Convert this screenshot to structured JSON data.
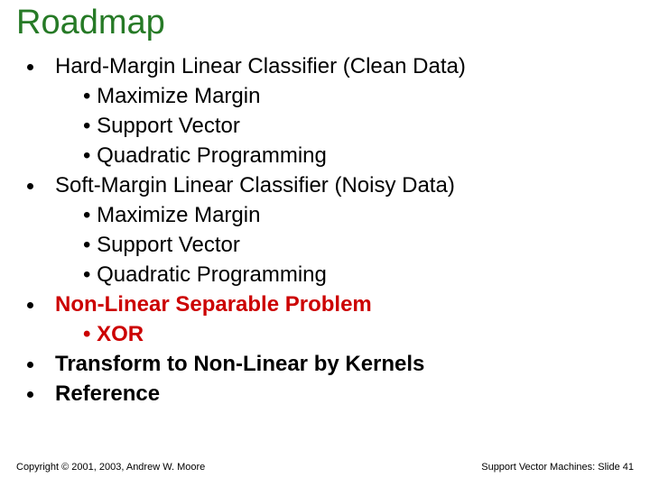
{
  "title": "Roadmap",
  "items": [
    {
      "label": "Hard-Margin Linear Classifier (Clean Data)",
      "subs": [
        "Maximize Margin",
        "Support Vector",
        "Quadratic Programming"
      ]
    },
    {
      "label": "Soft-Margin Linear Classifier (Noisy Data)",
      "subs": [
        "Maximize Margin",
        "Support Vector",
        "Quadratic Programming"
      ]
    },
    {
      "label": "Non-Linear Separable Problem",
      "label_class": "red",
      "subs": [
        "XOR"
      ],
      "subs_class": "red"
    },
    {
      "label": "Transform to Non-Linear by Kernels",
      "label_class": "bold",
      "subs": []
    },
    {
      "label": "Reference",
      "label_class": "bold",
      "subs": []
    }
  ],
  "footer": {
    "left": "Copyright © 2001, 2003, Andrew W. Moore",
    "right": "Support Vector Machines: Slide 41"
  }
}
